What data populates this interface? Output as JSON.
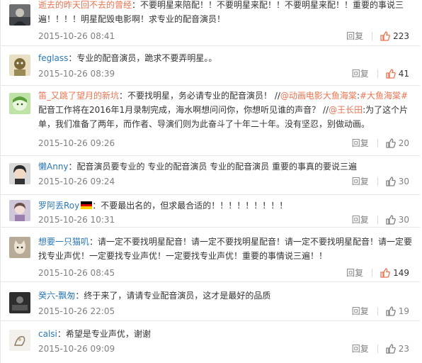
{
  "comments": [
    {
      "user": "逝去的昨天回不去的曾经",
      "text": "：不要明星来陪配！！不要明星来配！！不要明星来配！！重要的事说三遍！！！！明星配毁电影啊！求专业的配音演员！",
      "time": "2015-10-26 08:41",
      "reply_label": "回复",
      "likes": "223",
      "liked": true,
      "avatar_icon": "avatar-portrait-icon"
    },
    {
      "user": "feglass",
      "text": "：专业的配音演员，跪求不要弄明星。。",
      "time": "2015-10-26 08:39",
      "reply_label": "回复",
      "likes": "41",
      "liked": true,
      "avatar_icon": "avatar-cartoon-icon"
    },
    {
      "user": "笛_又跳了望月的新坑",
      "text_a": "：不要找明星，务必请专业的配音演员！ //",
      "mention_a": "@动画电影大鱼海棠",
      "text_b": ":",
      "mention_b": "#大鱼海棠#",
      "text_c": "配音工作将在2016年1月录制完成，海水啊想问问你，你想听见谁的声音？ //",
      "mention_c": "@王长田",
      "text_d": ":为了这个片单，我们准备了两年，而作者、导演们则为此奋斗了十年二十年。没有坚忍，别做动画。",
      "time": "2015-10-26 09:26",
      "reply_label": "回复",
      "likes": "20",
      "liked": false,
      "avatar_icon": "avatar-anime-icon"
    },
    {
      "user": "懒Anny",
      "text": "：配音演员要专业的    专业的配音演员   专业的配音演员   重要的事真的要说三遍",
      "time": "2015-10-26 09:24",
      "reply_label": "回复",
      "likes": "30",
      "liked": false,
      "avatar_icon": "avatar-girl-icon"
    },
    {
      "user": "罗阿丢Roy",
      "text": "：不要最出名的，但求最合适的！！！！！！！！！",
      "time": "2015-10-26 10:31",
      "reply_label": "回复",
      "likes": "30",
      "liked": false,
      "avatar_icon": "avatar-photo-icon",
      "flag_icon": "germany-flag-icon"
    },
    {
      "user": "想要一只猫叽",
      "text": "：请一定不要找明星配音！请一定不要找明星配音！请一定不要找明星配音！请一定要找专业声优！一定要找专业声优！一定要找专业声优！重要的事情说三遍！！",
      "time": "2015-10-26 08:45",
      "reply_label": "回复",
      "likes": "149",
      "liked": true,
      "avatar_icon": "avatar-cat-icon"
    },
    {
      "user": "癸六-飘匆",
      "text": "：终于来了，请请专业配音演员，这才是最好的品质",
      "time": "2015-10-26 22:05",
      "reply_label": "回复",
      "likes": "19",
      "liked": false,
      "avatar_icon": "avatar-dark-icon"
    },
    {
      "user": "calsi",
      "text": "：希望是专业声优，谢谢",
      "time": "2015-10-26 09:09",
      "reply_label": "回复",
      "likes": "23",
      "liked": false,
      "avatar_icon": "avatar-sketch-icon"
    }
  ],
  "colors": {
    "username": "#eb7350",
    "username_plain": "#2a77b8",
    "meta": "#808080",
    "like_active": "#eb7350",
    "divider": "#e8e8e8"
  }
}
